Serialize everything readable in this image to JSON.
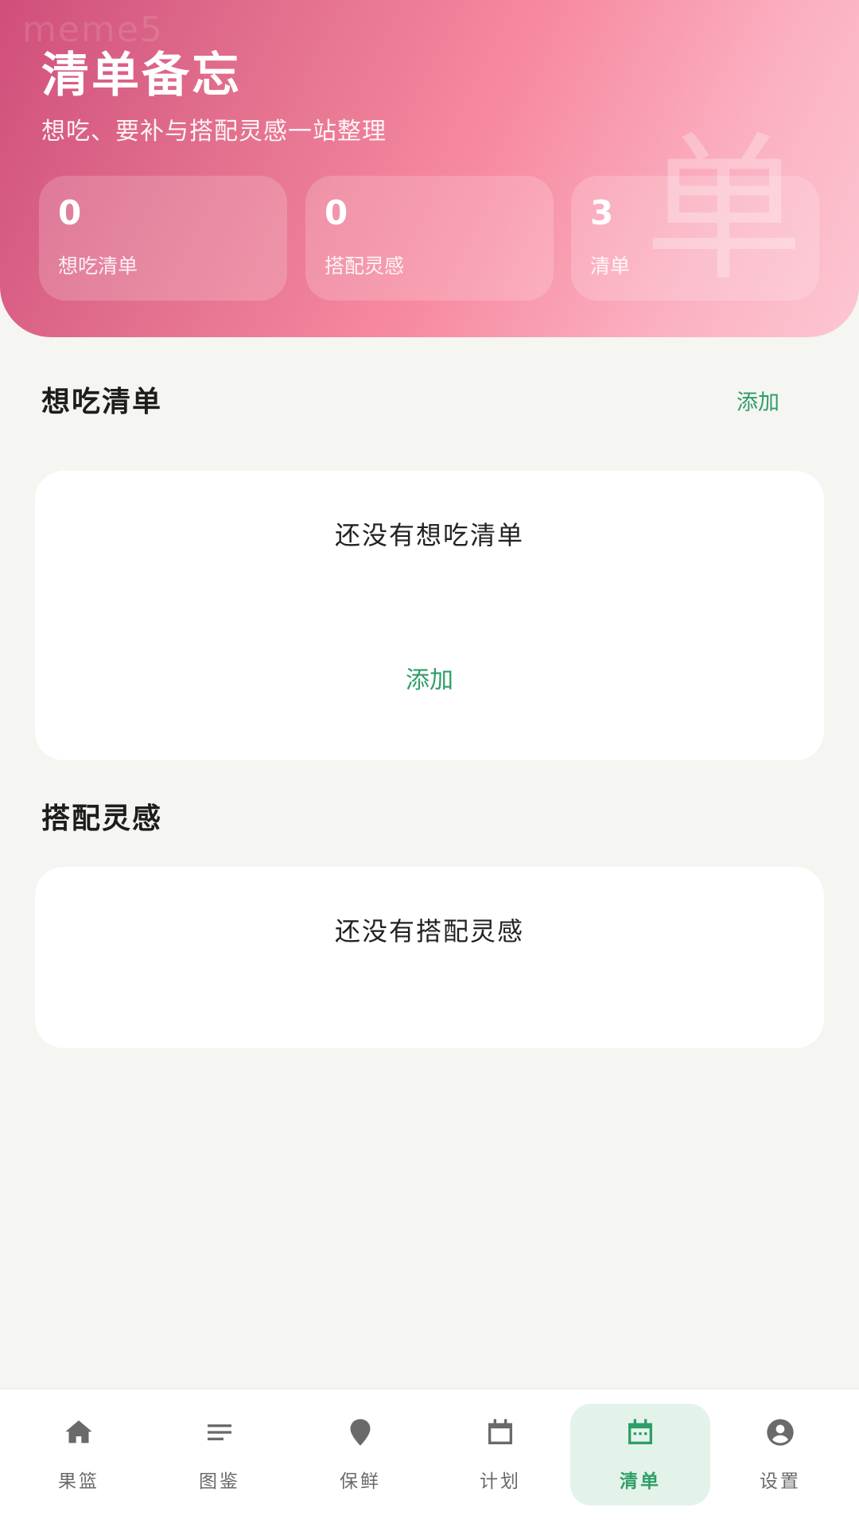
{
  "header": {
    "watermark": "meme5",
    "title": "清单备忘",
    "subtitle": "想吃、要补与搭配灵感一站整理",
    "decor_char": "单",
    "stats": [
      {
        "value": "0",
        "label": "想吃清单"
      },
      {
        "value": "0",
        "label": "搭配灵感"
      },
      {
        "value": "3",
        "label": "清单"
      }
    ]
  },
  "wishlist": {
    "title": "想吃清单",
    "add_label": "添加",
    "empty_text": "还没有想吃清单",
    "empty_add_label": "添加"
  },
  "pairing": {
    "title": "搭配灵感",
    "empty_text": "还没有搭配灵感"
  },
  "nav": {
    "items": [
      {
        "label": "果篮",
        "icon": "home-icon"
      },
      {
        "label": "图鉴",
        "icon": "list-lines-icon"
      },
      {
        "label": "保鲜",
        "icon": "location-pin-icon"
      },
      {
        "label": "计划",
        "icon": "calendar-icon"
      },
      {
        "label": "清单",
        "icon": "calendar-dots-icon",
        "active": true
      },
      {
        "label": "设置",
        "icon": "account-circle-icon"
      }
    ]
  },
  "colors": {
    "accent_green": "#2e9e68",
    "header_gradient_start": "#cf4f7b",
    "header_gradient_end": "#fdc6d2",
    "page_background": "#f5f5f1"
  }
}
